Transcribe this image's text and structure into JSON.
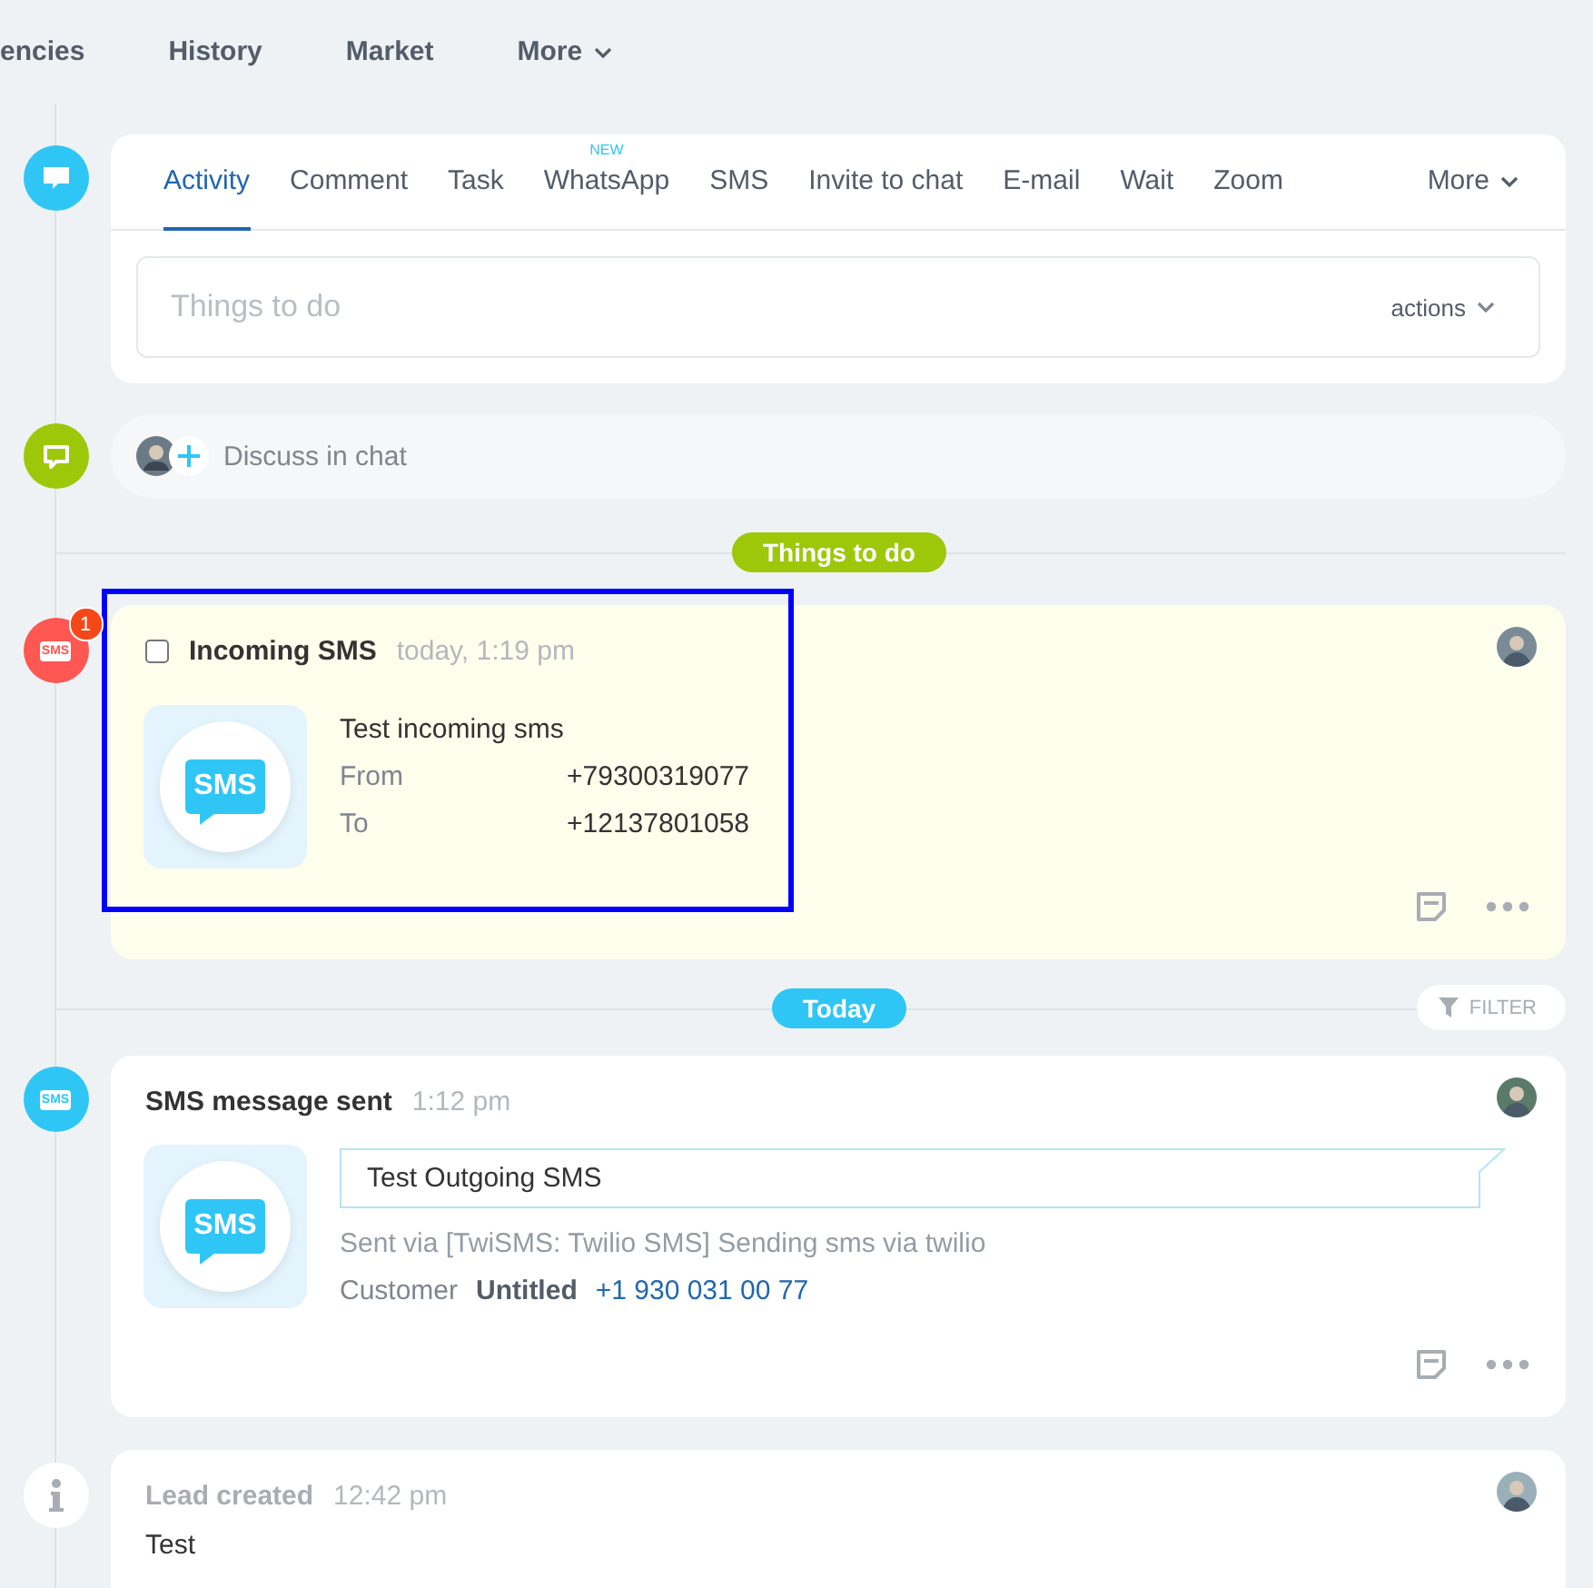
{
  "top_nav": [
    {
      "label": "encies",
      "dropdown": false
    },
    {
      "label": "History",
      "dropdown": false
    },
    {
      "label": "Market",
      "dropdown": false
    },
    {
      "label": "More",
      "dropdown": true
    }
  ],
  "composer": {
    "tabs": [
      {
        "label": "Activity",
        "selected": true
      },
      {
        "label": "Comment",
        "selected": false
      },
      {
        "label": "Task",
        "selected": false
      },
      {
        "label": "WhatsApp",
        "selected": false,
        "badge": "NEW"
      },
      {
        "label": "SMS",
        "selected": false
      },
      {
        "label": "Invite to chat",
        "selected": false
      },
      {
        "label": "E-mail",
        "selected": false
      },
      {
        "label": "Wait",
        "selected": false
      },
      {
        "label": "Zoom",
        "selected": false
      },
      {
        "label": "More",
        "selected": false,
        "dropdown": true
      }
    ],
    "field": {
      "placeholder": "Things to do"
    },
    "actions": "actions"
  },
  "chat": {
    "label": "Discuss in chat"
  },
  "things_to_do_divider": {
    "label": "Things to do",
    "color": "#9dc80a"
  },
  "incoming_sms": {
    "icon_label": "SMS",
    "badge": "1",
    "checked": false,
    "highlighted": true,
    "title": "Incoming SMS",
    "time": "today, 1:19 pm",
    "tile_label": "SMS",
    "message": "Test incoming sms",
    "fields": [
      {
        "label": "From",
        "value": "+79300319077"
      },
      {
        "label": "To",
        "value": "+12137801058"
      }
    ]
  },
  "today_divider": {
    "label": "Today",
    "color": "#2fc6f6",
    "filter": "FILTER"
  },
  "sms_sent": {
    "icon_label": "SMS",
    "title": "SMS message sent",
    "time": "1:12 pm",
    "tile_label": "SMS",
    "message": "Test Outgoing SMS",
    "via": "Sent via [TwiSMS: Twilio SMS] Sending sms via twilio",
    "customer_label": "Customer",
    "customer_name": "Untitled",
    "customer_phone": "+1 930 031 00 77"
  },
  "lead_created": {
    "title": "Lead created",
    "time": "12:42 pm",
    "lines": [
      "Test"
    ]
  }
}
